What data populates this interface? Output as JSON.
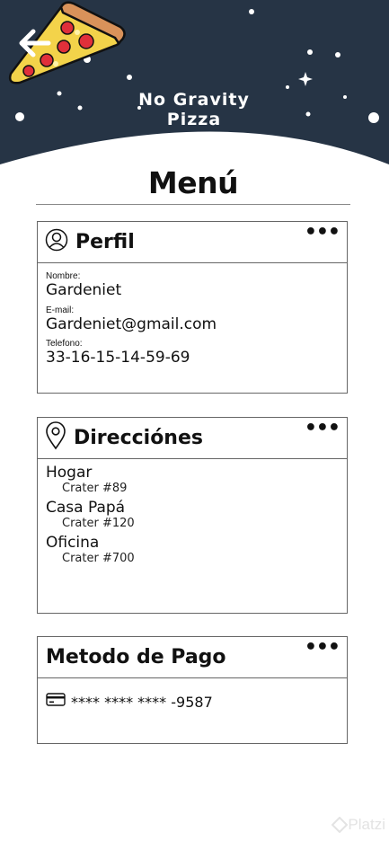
{
  "brand": {
    "name": "No Gravity Pizza"
  },
  "page": {
    "title": "Menú"
  },
  "profile": {
    "title": "Perfil",
    "more_label": "•••",
    "fields": [
      {
        "label": "Nombre:",
        "value": "Gardeniet"
      },
      {
        "label": "E-mail:",
        "value": "Gardeniet@gmail.com"
      },
      {
        "label": "Telefono:",
        "value": "33-16-15-14-59-69"
      }
    ]
  },
  "addresses": {
    "title": "Direcciónes",
    "more_label": "•••",
    "items": [
      {
        "name": "Hogar",
        "street": "Crater #89"
      },
      {
        "name": "Casa Papá",
        "street": "Crater #120"
      },
      {
        "name": "Oficina",
        "street": "Crater #700"
      }
    ]
  },
  "payment": {
    "title": "Metodo de Pago",
    "more_label": "•••",
    "card_number": "**** **** **** -9587"
  },
  "watermark": {
    "text": "Platzi"
  },
  "colors": {
    "header_bg": "#263445",
    "pizza_cheese": "#f3d34a",
    "pepperoni": "#e0303a",
    "crust": "#d9925a"
  },
  "icons": [
    "back-arrow-icon",
    "user-icon",
    "location-pin-icon",
    "credit-card-icon",
    "more-options-icon"
  ]
}
